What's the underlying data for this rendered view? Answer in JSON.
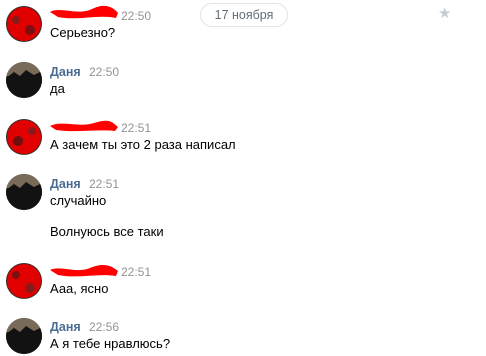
{
  "header": {
    "date": "17 ноября",
    "favorite_icon": "star-icon"
  },
  "messages": [
    {
      "sender": "",
      "time": "22:50",
      "lines": [
        "Серьезно?"
      ]
    },
    {
      "sender": "Даня",
      "time": "22:50",
      "lines": [
        "да"
      ]
    },
    {
      "sender": "",
      "time": "22:51",
      "lines": [
        "А зачем ты это 2 раза написал"
      ]
    },
    {
      "sender": "Даня",
      "time": "22:51",
      "lines": [
        "случайно",
        "Волнуюсь все таки"
      ]
    },
    {
      "sender": "",
      "time": "22:51",
      "lines": [
        "Ааа, ясно"
      ]
    },
    {
      "sender": "Даня",
      "time": "22:56",
      "lines": [
        "А я тебе нравлюсь?"
      ]
    }
  ],
  "colors": {
    "sender_name": "#4a6c91",
    "timestamp": "#939393",
    "redaction": "#ff0000",
    "date_pill_border": "#e1e3e6"
  }
}
